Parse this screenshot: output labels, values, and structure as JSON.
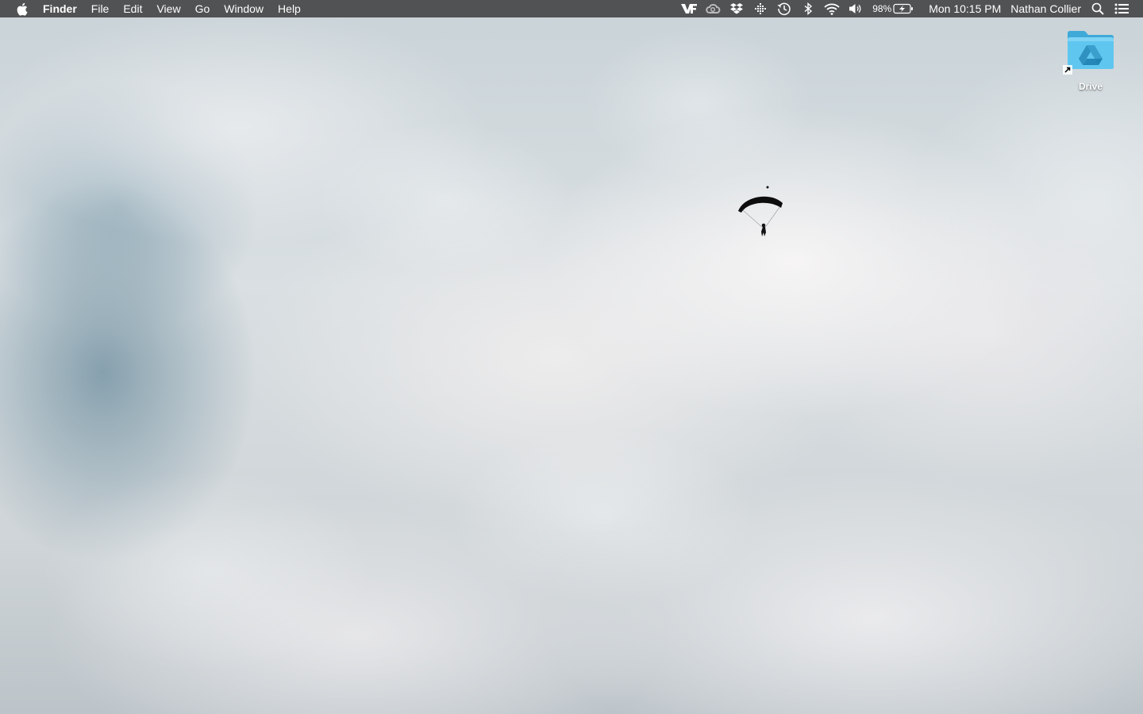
{
  "menubar": {
    "app_name": "Finder",
    "menus": [
      "File",
      "Edit",
      "View",
      "Go",
      "Window",
      "Help"
    ],
    "status_icons": [
      "vectorworks-icon",
      "creative-cloud-icon",
      "dropbox-icon",
      "grid-icon",
      "time-machine-icon",
      "bluetooth-icon",
      "wifi-icon",
      "volume-icon"
    ],
    "battery_percent": "98%",
    "clock": "Mon 10:15 PM",
    "user_name": "Nathan Collier"
  },
  "desktop": {
    "icons": [
      {
        "label": "Drive",
        "icon": "google-drive-folder-icon",
        "color": "#5fc6f0"
      }
    ]
  },
  "colors": {
    "menubar_bg": "#464648",
    "folder_blue": "#5fc6f0"
  }
}
